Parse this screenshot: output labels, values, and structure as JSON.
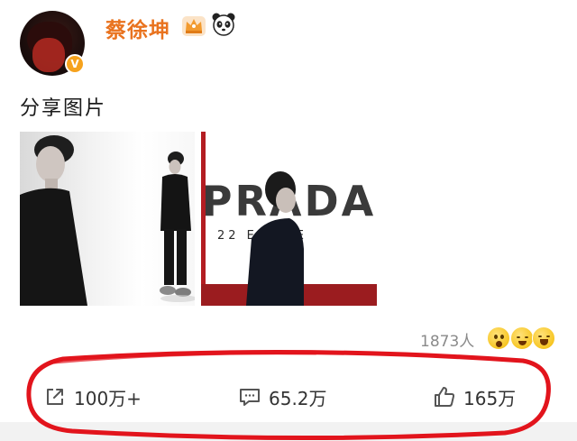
{
  "user": {
    "name": "蔡徐坤",
    "verified_badge": "V",
    "badges": [
      "crown-icon",
      "panda-icon"
    ]
  },
  "post": {
    "text": "分享图片",
    "images": [
      {
        "name": "portrait-photo"
      },
      {
        "name": "event-photo",
        "brand_text": "PRADA",
        "sub_text": "22  ENSWE"
      }
    ]
  },
  "reactions": {
    "count": "1873人",
    "emojis": [
      "surprised-emoji-icon",
      "laughing-emoji-icon",
      "grinning-emoji-icon"
    ]
  },
  "actions": {
    "share": {
      "label": "100万+",
      "icon": "share-icon"
    },
    "comment": {
      "label": "65.2万",
      "icon": "comment-icon"
    },
    "like": {
      "label": "165万",
      "icon": "thumbs-up-icon"
    }
  },
  "colors": {
    "username": "#e9731f",
    "verified": "#f6a21d",
    "annotation_circle": "#e2141c",
    "text_primary": "#1a1a1a",
    "text_secondary": "#8a8a8a"
  }
}
